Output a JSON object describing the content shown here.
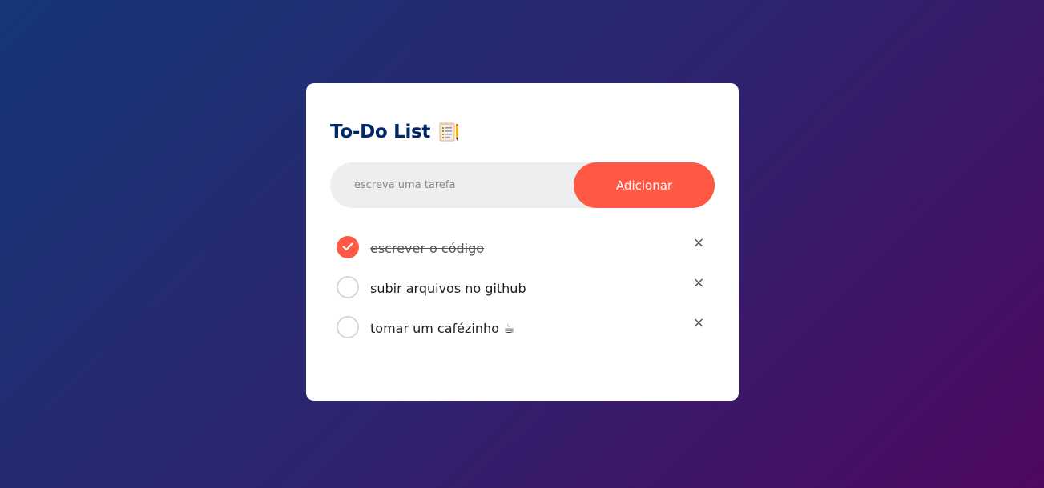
{
  "app": {
    "title": "To-Do List",
    "title_icon": "checklist-notepad-icon"
  },
  "input": {
    "placeholder": "escreva uma tarefa",
    "value": ""
  },
  "add_button": {
    "label": "Adicionar"
  },
  "tasks": [
    {
      "text": "escrever o código",
      "checked": true,
      "remove_label": "×"
    },
    {
      "text": "subir arquivos no github",
      "checked": false,
      "remove_label": "×"
    },
    {
      "text": "tomar um cafézinho ☕",
      "checked": false,
      "remove_label": "×"
    }
  ],
  "colors": {
    "accent": "#ff5945",
    "title": "#002765",
    "input_bg": "#edeef0",
    "bg_gradient_start": "#153677",
    "bg_gradient_end": "#4e085f"
  }
}
